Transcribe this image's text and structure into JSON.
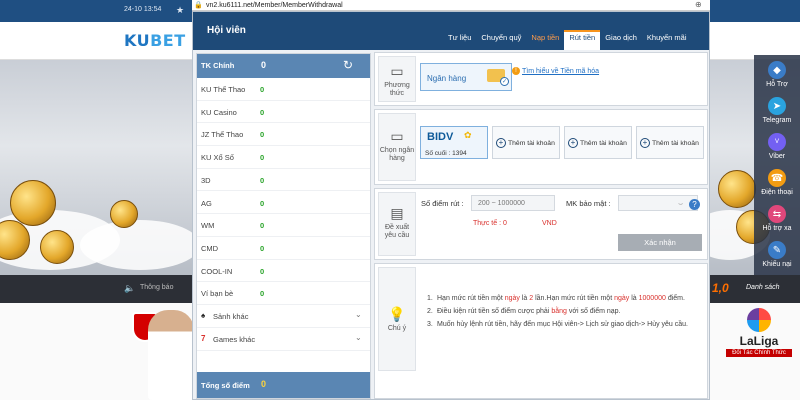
{
  "background": {
    "datetime": "24-10 13:54",
    "logo_ku": "KU",
    "logo_bet": "BET",
    "notice_label": "Thông báo",
    "score_text": "1,0",
    "more_link": "Danh sách",
    "laliga_name": "LaLiga",
    "laliga_sub": "Đối Tác Chính Thức",
    "side_contacts": [
      {
        "label": "Hỗ Trợ",
        "icon": "support-icon",
        "color": "#3a7cc7"
      },
      {
        "label": "Telegram",
        "icon": "telegram-icon",
        "color": "#2aa3df"
      },
      {
        "label": "Viber",
        "icon": "viber-icon",
        "color": "#7360f2"
      },
      {
        "label": "Điện thoại",
        "icon": "phone-icon",
        "color": "#f39c12"
      },
      {
        "label": "Hỗ trợ xa",
        "icon": "remote-icon",
        "color": "#e0477b"
      },
      {
        "label": "Khiếu nại",
        "icon": "complaint-icon",
        "color": "#3a7cc7"
      }
    ]
  },
  "browser": {
    "url": "vn2.ku6111.net/Member/MemberWithdrawal"
  },
  "modal": {
    "title": "Hội viên",
    "tabs": [
      {
        "label": "Tư liệu",
        "active": false
      },
      {
        "label": "Chuyển quỹ",
        "active": false
      },
      {
        "label": "Nạp tiền",
        "active": false
      },
      {
        "label": "Rút tiền",
        "active": true
      },
      {
        "label": "Giao dịch",
        "active": false
      },
      {
        "label": "Khuyến mãi",
        "active": false
      }
    ],
    "balances": {
      "main_label": "TK Chính",
      "main_value": "0",
      "accounts": [
        {
          "label": "KU Thể Thao",
          "value": "0"
        },
        {
          "label": "KU Casino",
          "value": "0"
        },
        {
          "label": "JZ Thể Thao",
          "value": "0"
        },
        {
          "label": "KU Xổ Số",
          "value": "0"
        },
        {
          "label": "3D",
          "value": "0"
        },
        {
          "label": "AG",
          "value": "0"
        },
        {
          "label": "WM",
          "value": "0"
        },
        {
          "label": "CMD",
          "value": "0"
        },
        {
          "label": "COOL-IN",
          "value": "0"
        },
        {
          "label": "Ví bạn bè",
          "value": "0"
        }
      ],
      "expandables": [
        {
          "label": "Sảnh khác",
          "icon": "spade-icon"
        },
        {
          "label": "Games khác",
          "icon": "seven-icon"
        }
      ],
      "total_label": "Tổng số điểm",
      "total_value": "0"
    },
    "withdraw": {
      "method_label": "Phương thức",
      "bank_option": "Ngân hàng",
      "learn_more": "Tìm hiểu về Tiền mã hóa",
      "choose_bank_label": "Chọn ngân hàng",
      "bank_name": "BIDV",
      "last_digits_label": "Số cuối :",
      "last_digits": "1394",
      "add_account_label": "Thêm tài khoản",
      "request_label": "Đề xuất yêu cầu",
      "amount_label": "Số điểm rút :",
      "amount_placeholder": "200 ~ 1000000",
      "security_label": "MK bảo mật :",
      "actual_label": "Thực tế :",
      "actual_value": "0",
      "currency": "VND",
      "confirm_label": "Xác nhận",
      "note_label": "Chú ý",
      "notes": [
        {
          "n": "1.",
          "parts": [
            {
              "t": "Hạn mức rút tiền một ",
              "red": false
            },
            {
              "t": "ngày",
              "red": true
            },
            {
              "t": " là ",
              "red": false
            },
            {
              "t": "2",
              "red": true
            },
            {
              "t": " lần.Hạn mức rút tiền một ",
              "red": false
            },
            {
              "t": "ngày",
              "red": true
            },
            {
              "t": " là ",
              "red": false
            },
            {
              "t": "1000000",
              "red": true
            },
            {
              "t": " điểm.",
              "red": false
            }
          ]
        },
        {
          "n": "2.",
          "parts": [
            {
              "t": "Điều kiện rút tiền số điểm cược phải ",
              "red": false
            },
            {
              "t": "bằng",
              "red": true
            },
            {
              "t": " với số điểm nạp.",
              "red": false
            }
          ]
        },
        {
          "n": "3.",
          "parts": [
            {
              "t": "Muốn hủy lệnh rút tiền, hãy đến mục Hội viên-> Lịch sử giao dịch-> Hủy yêu cầu.",
              "red": false
            }
          ]
        }
      ]
    }
  }
}
